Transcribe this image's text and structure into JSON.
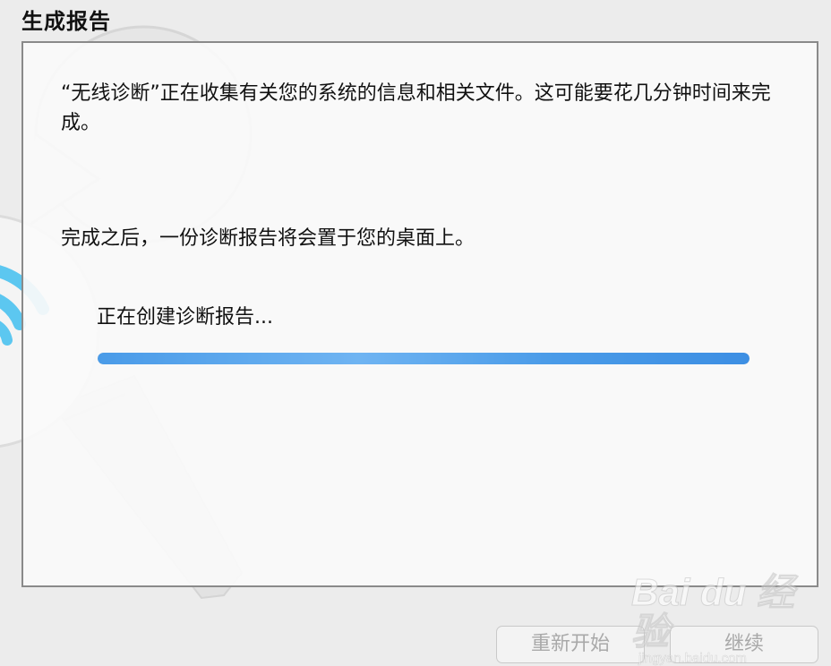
{
  "window": {
    "title": "生成报告"
  },
  "content": {
    "paragraph_1": "“无线诊断”正在收集有关您的系统的信息和相关文件。这可能要花几分钟时间来完成。",
    "paragraph_2": "完成之后，一份诊断报告将会置于您的桌面上。",
    "status_text": "正在创建诊断报告...",
    "progress_fraction": 1.0
  },
  "buttons": {
    "restart_label": "重新开始",
    "continue_label": "继续"
  },
  "watermark": {
    "logo_text": "Bai du 经验",
    "sub_text": "jingyan.baidu.com"
  },
  "colors": {
    "progress_bar": "#4a9be8",
    "wifi_icon": "#5cc7f0",
    "disabled_text": "#a9a9a9"
  },
  "icons": {
    "background_art": "wrench-screwdriver-wifi-icon"
  }
}
